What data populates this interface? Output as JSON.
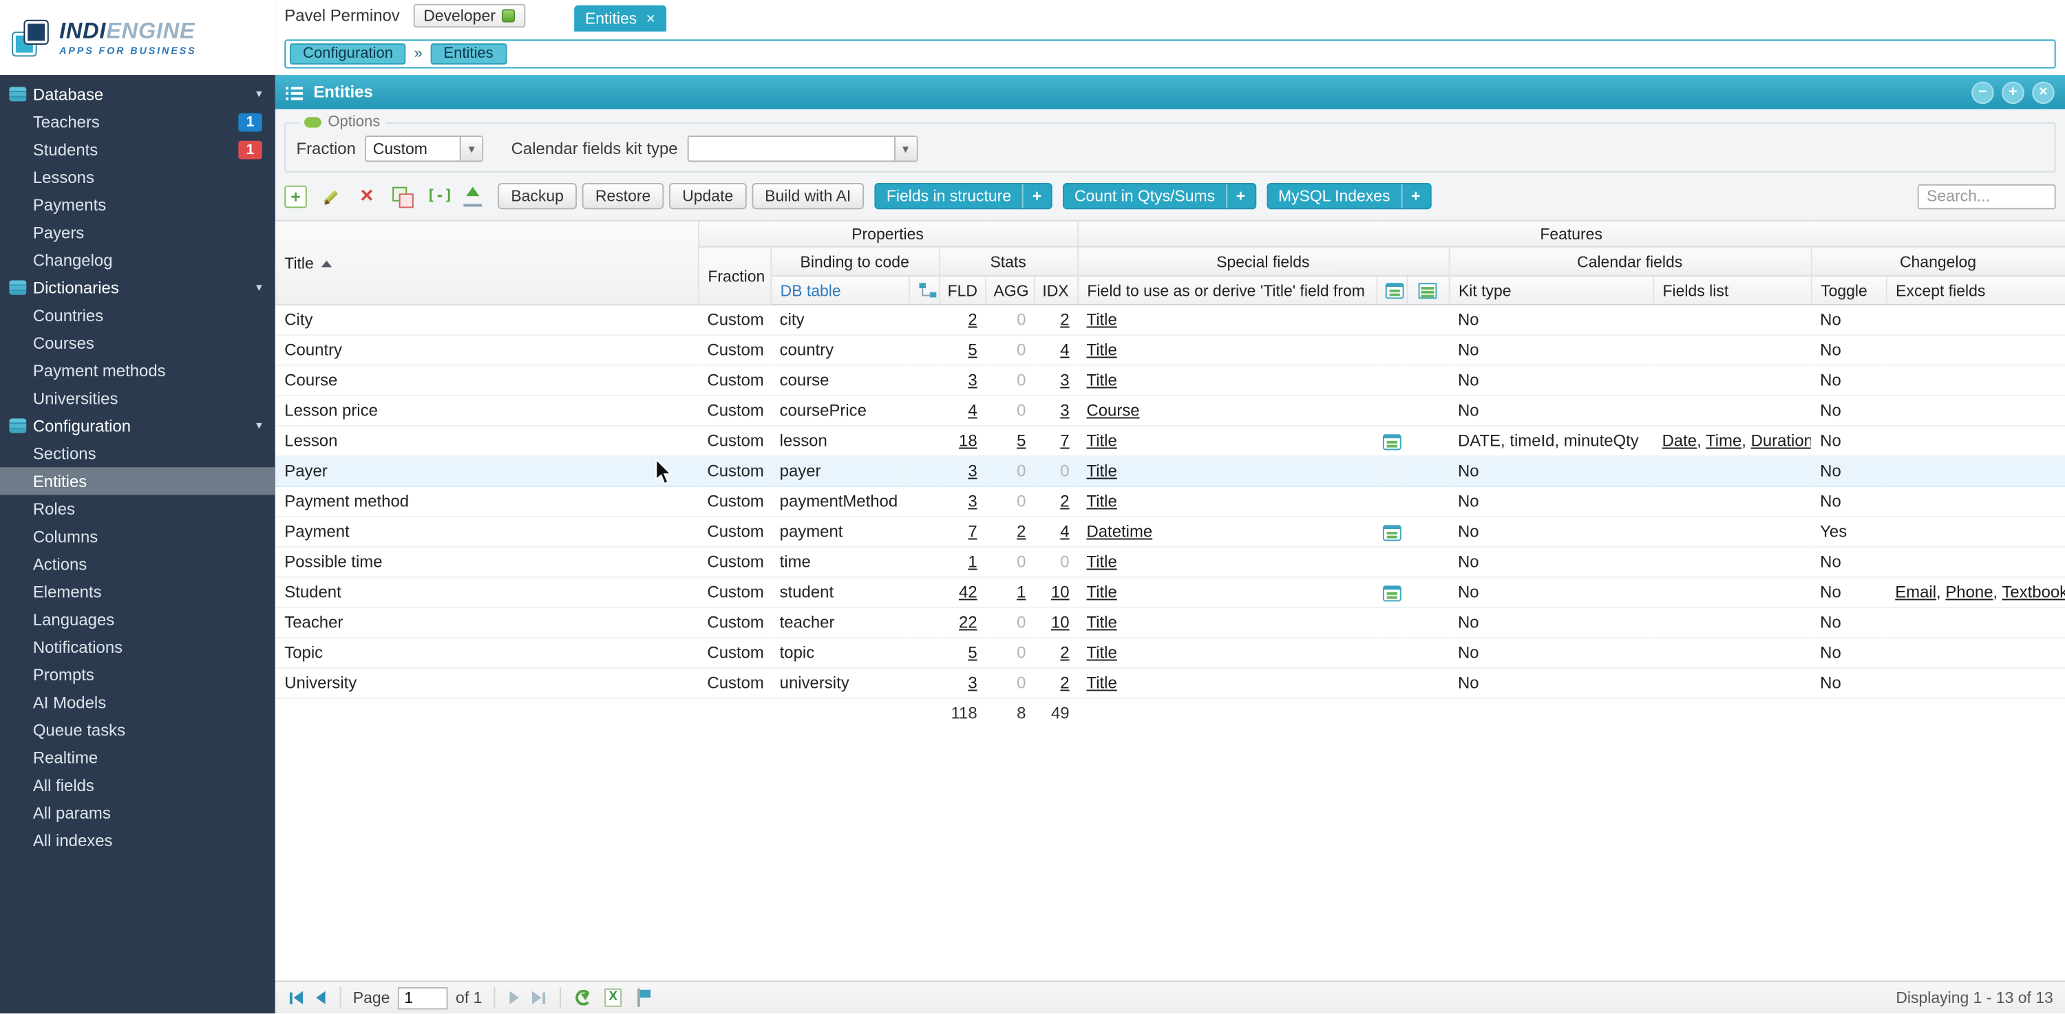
{
  "colors": {
    "accent": "#2aa6c5",
    "grad_top": "#45b6d2",
    "grad_bottom": "#2397b6",
    "sidebar_bg": "#2b3a4e",
    "sidebar_sel": "#6f7b88",
    "row_hover": "#e9f4fc"
  },
  "sidebar": {
    "logo": {
      "brand_bold": "INDI",
      "brand_light": "ENGINE",
      "tagline": "APPS FOR BUSINESS"
    },
    "items": [
      {
        "label": "Database",
        "type": "section"
      },
      {
        "label": "Teachers",
        "badge": "1",
        "badge_color": "#1d83cc"
      },
      {
        "label": "Students",
        "badge": "1",
        "badge_color": "#df4b4b"
      },
      {
        "label": "Lessons"
      },
      {
        "label": "Payments"
      },
      {
        "label": "Payers"
      },
      {
        "label": "Changelog"
      },
      {
        "label": "Dictionaries",
        "type": "section"
      },
      {
        "label": "Countries"
      },
      {
        "label": "Courses"
      },
      {
        "label": "Payment methods"
      },
      {
        "label": "Universities"
      },
      {
        "label": "Configuration",
        "type": "section"
      },
      {
        "label": "Sections"
      },
      {
        "label": "Entities",
        "selected": true
      },
      {
        "label": "Roles"
      },
      {
        "label": "Columns"
      },
      {
        "label": "Actions"
      },
      {
        "label": "Elements"
      },
      {
        "label": "Languages"
      },
      {
        "label": "Notifications"
      },
      {
        "label": "Prompts"
      },
      {
        "label": "AI Models"
      },
      {
        "label": "Queue tasks"
      },
      {
        "label": "Realtime"
      },
      {
        "label": "All fields"
      },
      {
        "label": "All params"
      },
      {
        "label": "All indexes"
      }
    ]
  },
  "topbar": {
    "user": "Pavel Perminov",
    "developer_label": "Developer",
    "tab_label": "Entities",
    "tab_close": "×"
  },
  "breadcrumb": {
    "items": [
      "Configuration",
      "Entities"
    ],
    "sep": "»"
  },
  "panel": {
    "title": "Entities",
    "win_min": "−",
    "win_max": "+",
    "win_close": "×"
  },
  "options": {
    "legend": "Options",
    "fraction_label": "Fraction",
    "fraction_value": "Custom",
    "kit_label": "Calendar fields kit type",
    "kit_value": ""
  },
  "toolbar": {
    "icons": [
      "add-icon",
      "edit-icon",
      "delete-icon",
      "copy-icon",
      "export-icon",
      "upload-icon"
    ],
    "buttons": [
      "Backup",
      "Restore",
      "Update",
      "Build with AI"
    ],
    "chips": [
      "Fields in structure",
      "Count in Qtys/Sums",
      "MySQL Indexes"
    ],
    "chip_plus": "+",
    "search_placeholder": "Search..."
  },
  "table": {
    "group_properties": "Properties",
    "group_features": "Features",
    "col_title": "Title",
    "col_fraction": "Fraction",
    "col_binding": "Binding to code",
    "col_stats": "Stats",
    "col_special": "Special fields",
    "col_calendar": "Calendar fields",
    "col_changelog": "Changelog",
    "col_dbtable": "DB table",
    "col_fld": "FLD",
    "col_agg": "AGG",
    "col_idx": "IDX",
    "col_field_to_use": "Field to use as or derive 'Title' field from",
    "col_kit": "Kit type",
    "col_fields_list": "Fields list",
    "col_toggle": "Toggle",
    "col_except": "Except fields",
    "rows": [
      {
        "title": "City",
        "fraction": "Custom",
        "db": "city",
        "fld": "2",
        "agg": "0",
        "idx": "2",
        "special": "Title",
        "cal_icon": false,
        "kit": "No",
        "fields_list": [],
        "toggle": "No",
        "except": [],
        "hover": false
      },
      {
        "title": "Country",
        "fraction": "Custom",
        "db": "country",
        "fld": "5",
        "agg": "0",
        "idx": "4",
        "special": "Title",
        "cal_icon": false,
        "kit": "No",
        "fields_list": [],
        "toggle": "No",
        "except": [],
        "hover": false
      },
      {
        "title": "Course",
        "fraction": "Custom",
        "db": "course",
        "fld": "3",
        "agg": "0",
        "idx": "3",
        "special": "Title",
        "cal_icon": false,
        "kit": "No",
        "fields_list": [],
        "toggle": "No",
        "except": [],
        "hover": false
      },
      {
        "title": "Lesson price",
        "fraction": "Custom",
        "db": "coursePrice",
        "fld": "4",
        "agg": "0",
        "idx": "3",
        "special": "Course",
        "cal_icon": false,
        "kit": "No",
        "fields_list": [],
        "toggle": "No",
        "except": [],
        "hover": false
      },
      {
        "title": "Lesson",
        "fraction": "Custom",
        "db": "lesson",
        "fld": "18",
        "agg": "5",
        "idx": "7",
        "special": "Title",
        "cal_icon": true,
        "kit": "DATE, timeId, minuteQty",
        "fields_list": [
          "Date",
          "Time",
          "Duration"
        ],
        "toggle": "No",
        "except": [],
        "hover": false
      },
      {
        "title": "Payer",
        "fraction": "Custom",
        "db": "payer",
        "fld": "3",
        "agg": "0",
        "idx": "0",
        "special": "Title",
        "cal_icon": false,
        "kit": "No",
        "fields_list": [],
        "toggle": "No",
        "except": [],
        "hover": true
      },
      {
        "title": "Payment method",
        "fraction": "Custom",
        "db": "paymentMethod",
        "fld": "3",
        "agg": "0",
        "idx": "2",
        "special": "Title",
        "cal_icon": false,
        "kit": "No",
        "fields_list": [],
        "toggle": "No",
        "except": [],
        "hover": false
      },
      {
        "title": "Payment",
        "fraction": "Custom",
        "db": "payment",
        "fld": "7",
        "agg": "2",
        "idx": "4",
        "special": "Datetime",
        "cal_icon": true,
        "kit": "No",
        "fields_list": [],
        "toggle": "Yes",
        "except": [],
        "hover": false
      },
      {
        "title": "Possible time",
        "fraction": "Custom",
        "db": "time",
        "fld": "1",
        "agg": "0",
        "idx": "0",
        "special": "Title",
        "cal_icon": false,
        "kit": "No",
        "fields_list": [],
        "toggle": "No",
        "except": [],
        "hover": false
      },
      {
        "title": "Student",
        "fraction": "Custom",
        "db": "student",
        "fld": "42",
        "agg": "1",
        "idx": "10",
        "special": "Title",
        "cal_icon": true,
        "kit": "No",
        "fields_list": [],
        "toggle": "No",
        "except": [
          "Email",
          "Phone",
          "Textbooks"
        ],
        "hover": false
      },
      {
        "title": "Teacher",
        "fraction": "Custom",
        "db": "teacher",
        "fld": "22",
        "agg": "0",
        "idx": "10",
        "special": "Title",
        "cal_icon": false,
        "kit": "No",
        "fields_list": [],
        "toggle": "No",
        "except": [],
        "hover": false
      },
      {
        "title": "Topic",
        "fraction": "Custom",
        "db": "topic",
        "fld": "5",
        "agg": "0",
        "idx": "2",
        "special": "Title",
        "cal_icon": false,
        "kit": "No",
        "fields_list": [],
        "toggle": "No",
        "except": [],
        "hover": false
      },
      {
        "title": "University",
        "fraction": "Custom",
        "db": "university",
        "fld": "3",
        "agg": "0",
        "idx": "2",
        "special": "Title",
        "cal_icon": false,
        "kit": "No",
        "fields_list": [],
        "toggle": "No",
        "except": [],
        "hover": false
      }
    ],
    "summary": {
      "fld": "118",
      "agg": "8",
      "idx": "49"
    }
  },
  "pagination": {
    "page_label": "Page",
    "page_value": "1",
    "of_text": "of 1",
    "displaying": "Displaying 1 - 13 of 13"
  }
}
